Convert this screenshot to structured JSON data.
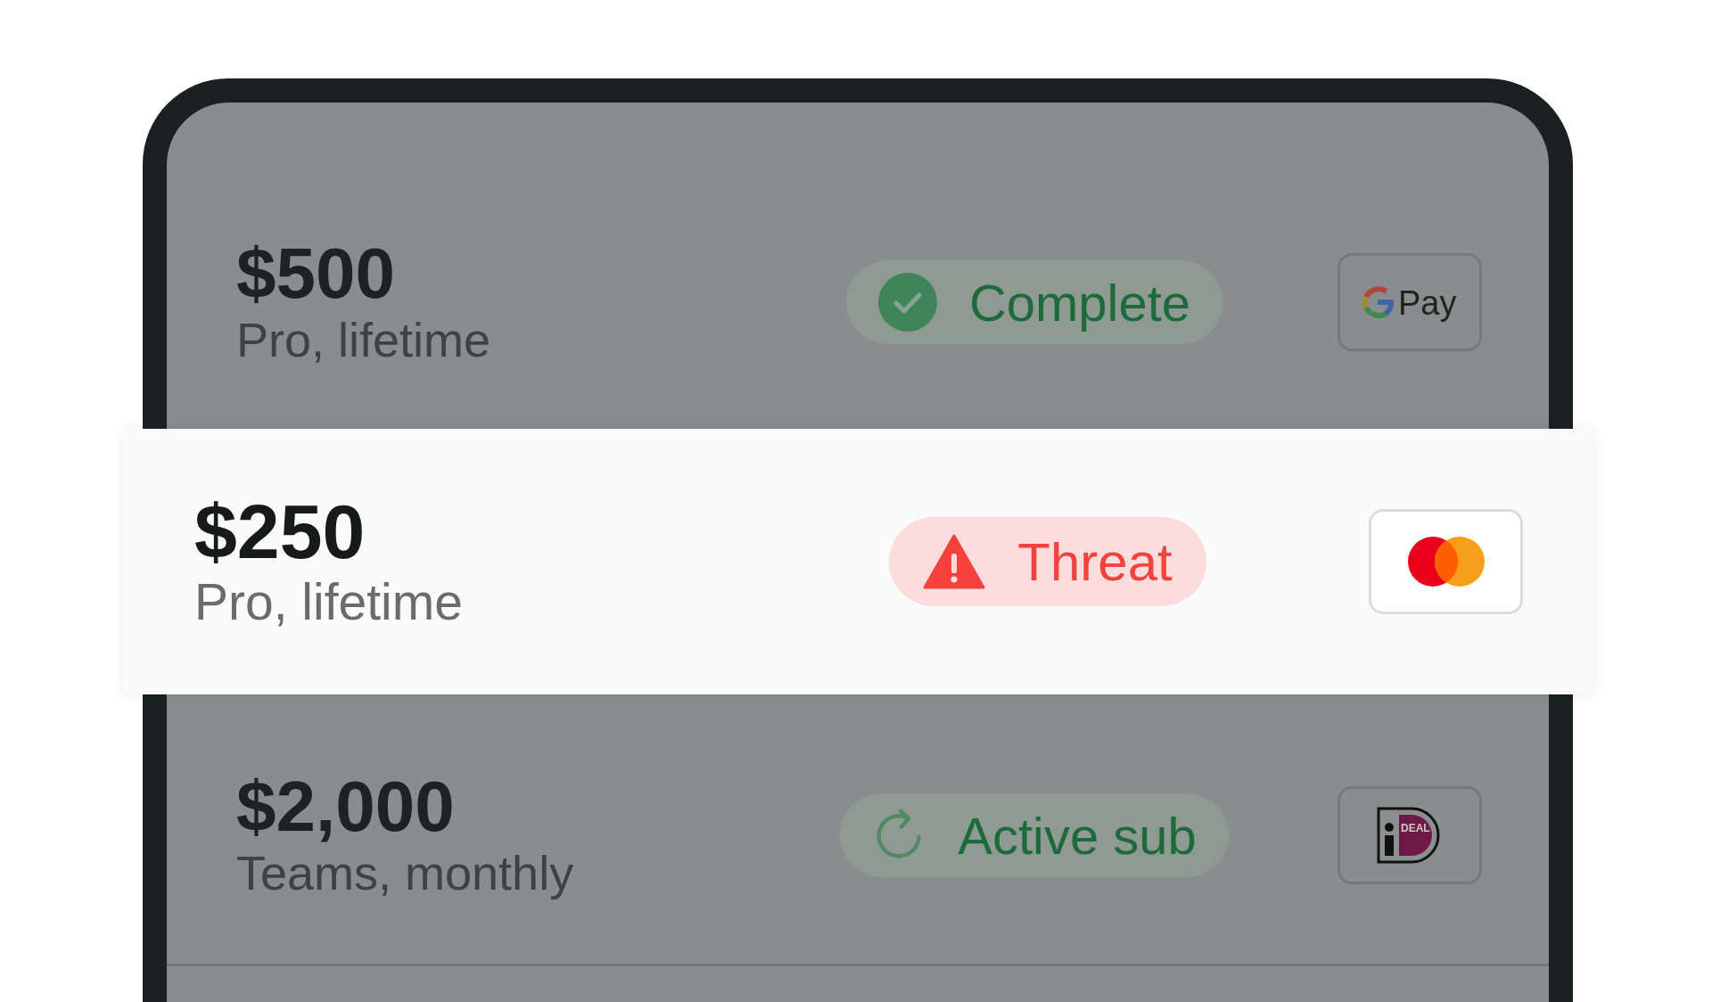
{
  "rows": [
    {
      "amount": "$500",
      "plan": "Pro, lifetime",
      "selected": false,
      "status": {
        "kind": "complete",
        "label": "Complete"
      },
      "payment": {
        "kind": "gpay",
        "label": "Pay"
      }
    },
    {
      "amount": "$250",
      "plan": "Pro, lifetime",
      "selected": true,
      "status": {
        "kind": "threat",
        "label": "Threat"
      },
      "payment": {
        "kind": "mastercard"
      }
    },
    {
      "amount": "$2,000",
      "plan": "Teams, monthly",
      "selected": false,
      "status": {
        "kind": "active",
        "label": "Active sub"
      },
      "payment": {
        "kind": "ideal",
        "label": "DEAL"
      }
    }
  ]
}
